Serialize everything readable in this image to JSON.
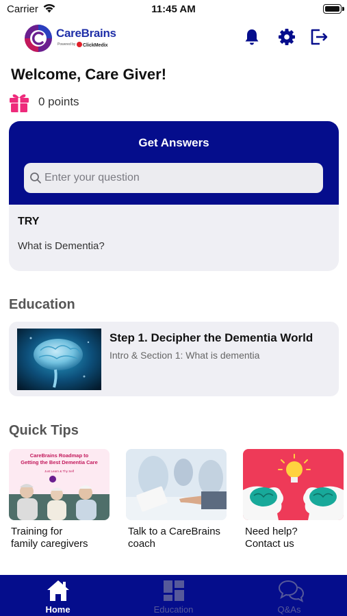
{
  "status_bar": {
    "carrier": "Carrier",
    "time": "11:45 AM"
  },
  "header": {
    "logo_title": "CareBrains",
    "logo_powered": "Powered by",
    "logo_brand": "ClickMedix",
    "icons": [
      "bell-icon",
      "gear-icon",
      "logout-icon"
    ],
    "accent_color": "#050d8c"
  },
  "welcome": "Welcome, Care Giver!",
  "points": {
    "text": "0 points",
    "icon": "gift-icon",
    "color": "#ee2a7b"
  },
  "answers": {
    "title": "Get Answers",
    "search_placeholder": "Enter your question",
    "try_label": "TRY",
    "try_items": [
      "What is Dementia?"
    ]
  },
  "education": {
    "section_title": "Education",
    "items": [
      {
        "title": "Step 1. Decipher the Dementia World",
        "subtitle": "Intro & Section 1: What is dementia"
      }
    ]
  },
  "quick_tips": {
    "section_title": "Quick Tips",
    "items": [
      {
        "line1": "Training for",
        "line2": "family caregivers",
        "image_heading1": "CareBrains Roadmap to",
        "image_heading2": "Getting the Best Dementia Care",
        "image_caption": "Just Learn & Thy Self"
      },
      {
        "line1": "Talk to a CareBrains",
        "line2": "coach"
      },
      {
        "line1": "Need help?",
        "line2": "Contact us"
      }
    ]
  },
  "tabs": [
    {
      "label": "Home",
      "icon": "home-icon",
      "active": true
    },
    {
      "label": "Education",
      "icon": "grid-icon",
      "active": false
    },
    {
      "label": "Q&As",
      "icon": "chat-bubbles-icon",
      "active": false
    }
  ]
}
